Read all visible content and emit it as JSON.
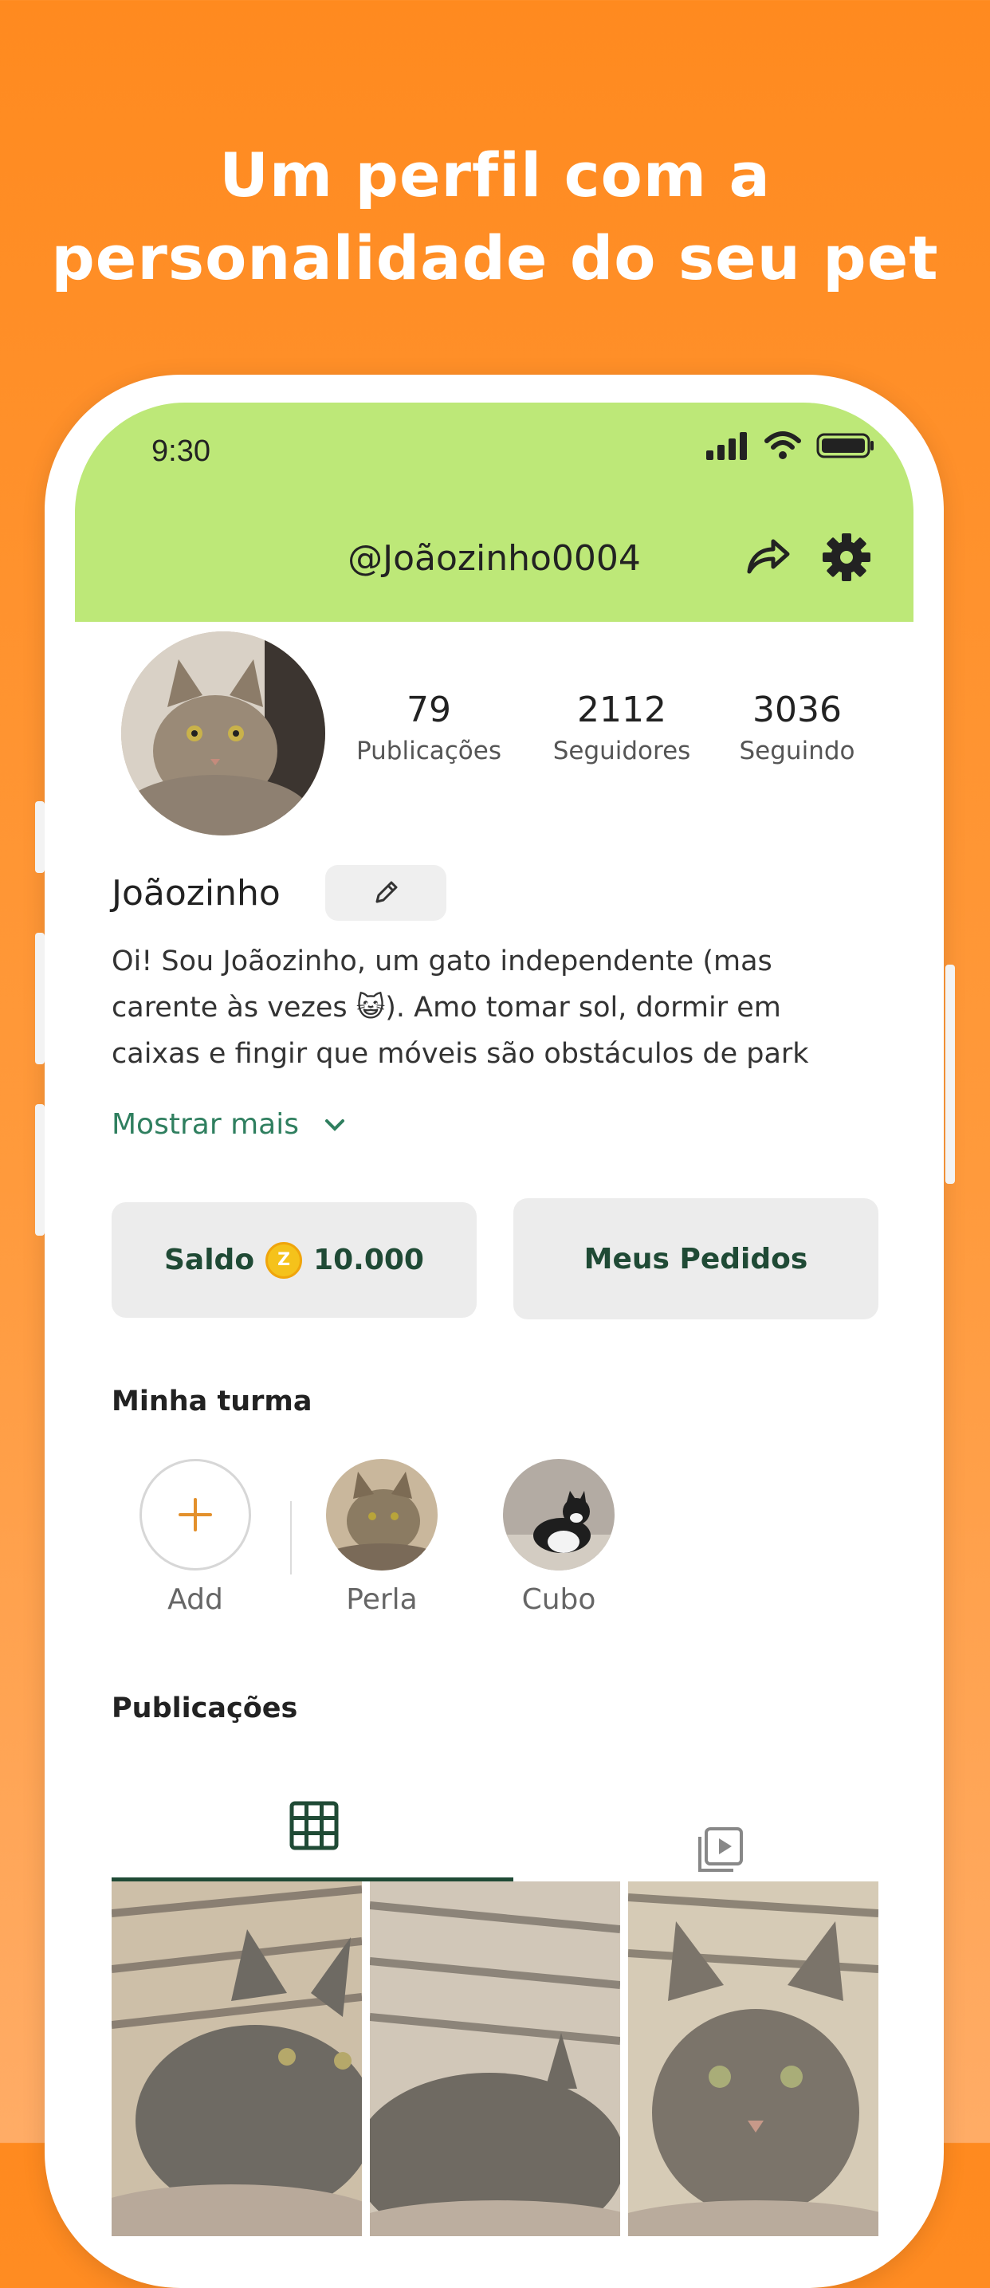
{
  "headline": {
    "line1": "Um perfil com a",
    "line2": "personalidade do seu pet"
  },
  "status_bar": {
    "time": "9:30",
    "icons": [
      "signal-icon",
      "wifi-icon",
      "battery-icon"
    ]
  },
  "header": {
    "handle": "@Joãozinho0004",
    "share_icon": "share-icon",
    "settings_icon": "gear-icon"
  },
  "profile": {
    "name": "Joãozinho",
    "stats": [
      {
        "value": "79",
        "label": "Publicações"
      },
      {
        "value": "2112",
        "label": "Seguidores"
      },
      {
        "value": "3036",
        "label": "Seguindo"
      }
    ],
    "bio": "Oi! Sou Joãozinho, um gato independente (mas\ncarente às vezes 😺). Amo tomar sol, dormir em\ncaixas e fingir que móveis são obstáculos de park",
    "show_more": "Mostrar mais"
  },
  "actions": {
    "balance_label": "Saldo",
    "balance_coin": "Z",
    "balance_value": "10.000",
    "orders_label": "Meus Pedidos"
  },
  "turma": {
    "title": "Minha turma",
    "add_label": "Add",
    "friends": [
      {
        "name": "Perla"
      },
      {
        "name": "Cubo"
      }
    ]
  },
  "publications": {
    "title": "Publicações",
    "tabs": [
      "grid-icon",
      "video-icon"
    ]
  },
  "colors": {
    "background_orange": "#ff8a1f",
    "header_green": "#bde878",
    "accent_dark_green": "#1f4a35",
    "link_green": "#2f7f5f",
    "add_plus": "#e3902c",
    "coin_gold": "#f5c21b"
  }
}
